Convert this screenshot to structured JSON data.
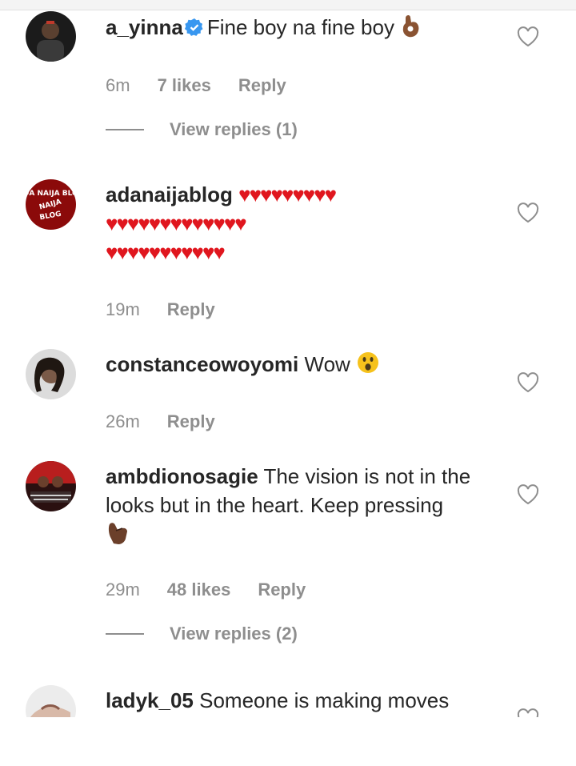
{
  "comments": [
    {
      "username": "a_yinna",
      "verified": true,
      "text": "Fine boy na fine boy",
      "emoji": "ok-hand-icon",
      "time": "6m",
      "likes": "7 likes",
      "reply_label": "Reply",
      "view_replies": "View replies (1)"
    },
    {
      "username": "adanaijablog",
      "avatar_text": "ADA NAIJA BLOG",
      "hearts_line1": "♥♥♥♥♥♥♥♥♥",
      "hearts_line2": "♥♥♥♥♥♥♥♥♥♥♥♥♥",
      "hearts_line3": "♥♥♥♥♥♥♥♥♥♥♥",
      "time": "19m",
      "reply_label": "Reply"
    },
    {
      "username": "constanceowoyomi",
      "text": "Wow",
      "emoji": "astonished-face-icon",
      "time": "26m",
      "reply_label": "Reply"
    },
    {
      "username": "ambdionosagie",
      "text_line1": "The vision is not in the",
      "text_line2": "looks but in the heart. Keep pressing",
      "emoji": "call-me-hand-icon",
      "time": "29m",
      "likes": "48 likes",
      "reply_label": "Reply",
      "view_replies": "View replies (2)"
    },
    {
      "username": "ladyk_05",
      "text": "Someone is making moves"
    }
  ],
  "colors": {
    "text": "#262626",
    "muted": "#8e8e8e",
    "heart": "#e0161e",
    "verified": "#3897f0"
  }
}
